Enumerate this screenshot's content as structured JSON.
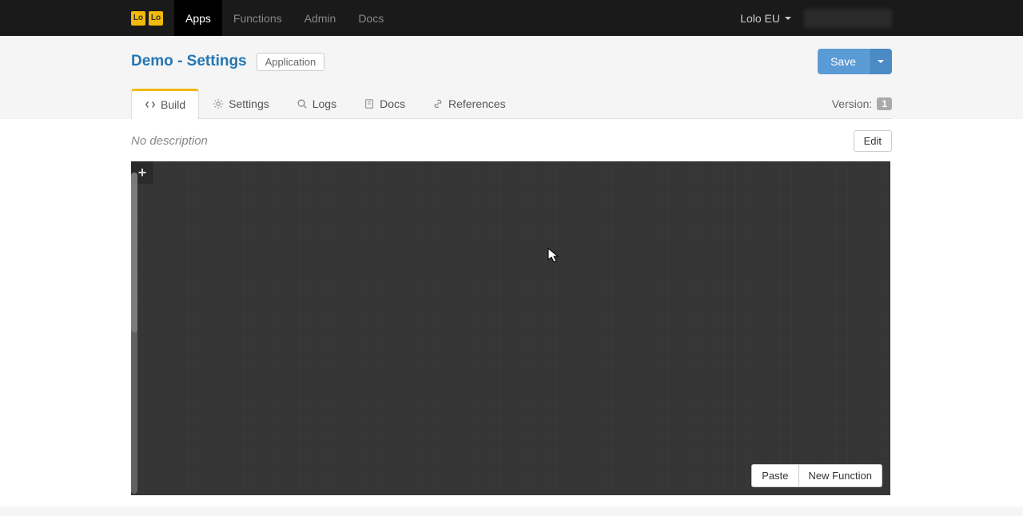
{
  "nav": {
    "items": [
      "Apps",
      "Functions",
      "Admin",
      "Docs"
    ],
    "active_index": 0,
    "region": "Lolo EU"
  },
  "header": {
    "title": "Demo - Settings",
    "badge": "Application",
    "save_label": "Save"
  },
  "tabs": {
    "items": [
      {
        "label": "Build",
        "icon": "code-icon"
      },
      {
        "label": "Settings",
        "icon": "gear-icon"
      },
      {
        "label": "Logs",
        "icon": "search-icon"
      },
      {
        "label": "Docs",
        "icon": "book-icon"
      },
      {
        "label": "References",
        "icon": "link-icon"
      }
    ],
    "active_index": 0,
    "version_label": "Version:",
    "version_value": "1"
  },
  "content": {
    "no_description": "No description",
    "edit_label": "Edit"
  },
  "canvas": {
    "add_label": "+",
    "paste_label": "Paste",
    "new_function_label": "New Function"
  }
}
